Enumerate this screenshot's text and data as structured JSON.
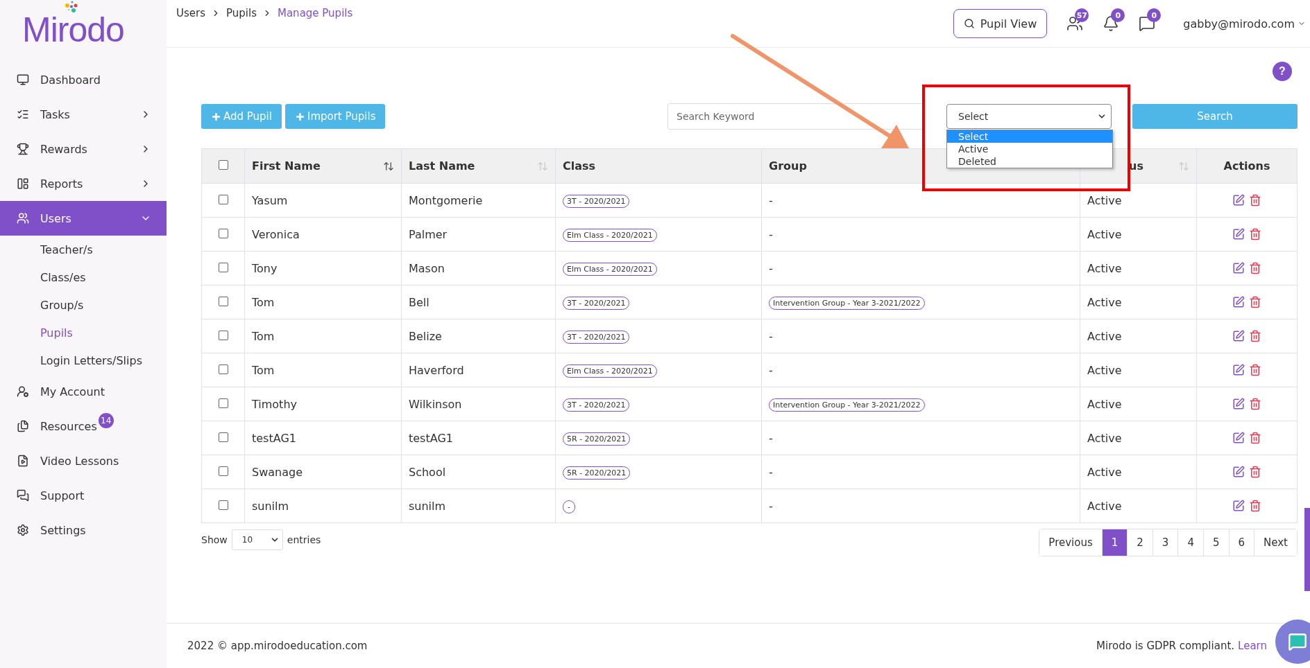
{
  "logo": {
    "text": "Mirodo"
  },
  "sidebar": {
    "items": [
      {
        "label": "Dashboard",
        "selected": false
      },
      {
        "label": "Tasks",
        "selected": false,
        "expanded": false
      },
      {
        "label": "Rewards",
        "selected": false,
        "expanded": false
      },
      {
        "label": "Reports",
        "selected": false,
        "expanded": false
      },
      {
        "label": "Users",
        "selected": true,
        "expanded": true,
        "children": [
          {
            "label": "Teacher/s",
            "selected": false
          },
          {
            "label": "Class/es",
            "selected": false
          },
          {
            "label": "Group/s",
            "selected": false
          },
          {
            "label": "Pupils",
            "selected": true
          },
          {
            "label": "Login Letters/Slips",
            "selected": false
          }
        ]
      },
      {
        "label": "My Account",
        "selected": false
      },
      {
        "label": "Resources",
        "selected": false,
        "badge": "14"
      },
      {
        "label": "Video Lessons",
        "selected": false
      },
      {
        "label": "Support",
        "selected": false
      },
      {
        "label": "Settings",
        "selected": false
      }
    ]
  },
  "breadcrumb": [
    {
      "label": "Users",
      "current": false
    },
    {
      "label": "Pupils",
      "current": false
    },
    {
      "label": "Manage Pupils",
      "current": true
    }
  ],
  "header": {
    "help": "?",
    "pupil_view": "Pupil View",
    "badges": [
      "57",
      "0",
      "0"
    ],
    "user": "gabby@mirodo.com"
  },
  "toolbar": {
    "buttons": [
      "Add Pupil",
      "Import Pupils"
    ],
    "search": {
      "placeholder": "Search Keyword"
    },
    "status_select": {
      "value": "Select",
      "open": true,
      "options": [
        {
          "label": "Select",
          "selected": true
        },
        {
          "label": "Active",
          "selected": false
        },
        {
          "label": "Deleted",
          "selected": false
        }
      ]
    },
    "search_button": "Search"
  },
  "table": {
    "header_checkbox": {
      "checked": false
    },
    "columns": [
      {
        "label": "First Name",
        "sortable": true,
        "sorted": true
      },
      {
        "label": "Last Name",
        "sortable": true,
        "sorted": false
      },
      {
        "label": "Class",
        "sortable": false
      },
      {
        "label": "Group",
        "sortable": false
      },
      {
        "label": "us",
        "sortable": true,
        "sorted": false
      },
      {
        "label": "Actions",
        "sortable": false
      }
    ],
    "rows": [
      {
        "checked": false,
        "first": "Yasum",
        "last": "Montgomerie",
        "class": "3T - 2020/2021",
        "group": "-",
        "status": "Active"
      },
      {
        "checked": false,
        "first": "Veronica",
        "last": "Palmer",
        "class": "Elm Class - 2020/2021",
        "group": "-",
        "status": "Active"
      },
      {
        "checked": false,
        "first": "Tony",
        "last": "Mason",
        "class": "Elm Class - 2020/2021",
        "group": "-",
        "status": "Active"
      },
      {
        "checked": false,
        "first": "Tom",
        "last": "Bell",
        "class": "3T - 2020/2021",
        "group": "Intervention Group - Year 3-2021/2022",
        "status": "Active"
      },
      {
        "checked": false,
        "first": "Tom",
        "last": "Belize",
        "class": "3T - 2020/2021",
        "group": "-",
        "status": "Active"
      },
      {
        "checked": false,
        "first": "Tom",
        "last": "Haverford",
        "class": "Elm Class - 2020/2021",
        "group": "-",
        "status": "Active"
      },
      {
        "checked": false,
        "first": "Timothy",
        "last": "Wilkinson",
        "class": "3T - 2020/2021",
        "group": "Intervention Group - Year 3-2021/2022",
        "status": "Active"
      },
      {
        "checked": false,
        "first": "testAG1",
        "last": "testAG1",
        "class": "5R - 2020/2021",
        "group": "-",
        "status": "Active"
      },
      {
        "checked": false,
        "first": "Swanage",
        "last": "School",
        "class": "5R - 2020/2021",
        "group": "-",
        "status": "Active"
      },
      {
        "checked": false,
        "first": "sunilm",
        "last": "sunilm",
        "class": "-",
        "group": "-",
        "status": "Active"
      }
    ]
  },
  "entries": {
    "show": "Show",
    "value": "10",
    "suffix": "entries"
  },
  "pagination": {
    "previous": "Previous",
    "pages": [
      {
        "label": "1",
        "selected": true
      },
      {
        "label": "2",
        "selected": false
      },
      {
        "label": "3",
        "selected": false
      },
      {
        "label": "4",
        "selected": false
      },
      {
        "label": "5",
        "selected": false
      },
      {
        "label": "6",
        "selected": false
      }
    ],
    "next": "Next"
  },
  "footer": {
    "copyright": "2022 © app.mirodoeducation.com",
    "gdpr": "Mirodo is GDPR compliant.",
    "link": "Learn"
  }
}
